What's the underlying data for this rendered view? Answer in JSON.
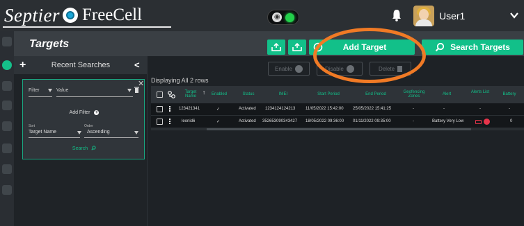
{
  "header": {
    "logo_part1": "Septier",
    "logo_part2": "FreeCell",
    "username": "User1"
  },
  "page": {
    "title": "Targets",
    "add_target_label": "Add Target",
    "search_targets_label": "Search Targets"
  },
  "left_panel": {
    "title": "Recent Searches",
    "filter_label": "Filter",
    "value_label": "Value",
    "add_filter_label": "Add Filter",
    "sort_label": "Sort",
    "order_label": "Order",
    "sort_value": "Target Name",
    "order_value": "Ascending",
    "search_label": "Search"
  },
  "grid": {
    "enable_label": "Enable",
    "disable_label": "Disable",
    "delete_label": "Delete",
    "displaying_text": "Displaying All 2 rows",
    "columns": {
      "target_name": "Target Name",
      "enabled": "Enabled",
      "status": "Status",
      "imei": "IMEI",
      "start_period": "Start Period",
      "end_period": "End Period",
      "geofencing_zones": "Geofencing Zones",
      "alert": "Alert",
      "alerts_list": "Alerts List",
      "battery": "Battery"
    },
    "rows": [
      {
        "target_name": "123421341",
        "enabled": "✓",
        "status": "Activated",
        "imei": "1234124124213",
        "start_period": "11/05/2022 15:42:00",
        "end_period": "25/05/2022 15:41:25",
        "geofencing_zones": "-",
        "alert": "-",
        "alerts_list": "-",
        "battery": "-"
      },
      {
        "target_name": "leonid6",
        "enabled": "✓",
        "status": "Activated",
        "imei": "352653090343427",
        "start_period": "18/05/2022 09:36:00",
        "end_period": "01/11/2022 09:35:00",
        "geofencing_zones": "-",
        "alert": "Battery Very Low",
        "alerts_list": "",
        "battery": "0"
      }
    ]
  },
  "colors": {
    "accent": "#12c089",
    "highlight": "#f07a25",
    "alert_red": "#e8344a",
    "status_green": "#22d04a"
  }
}
